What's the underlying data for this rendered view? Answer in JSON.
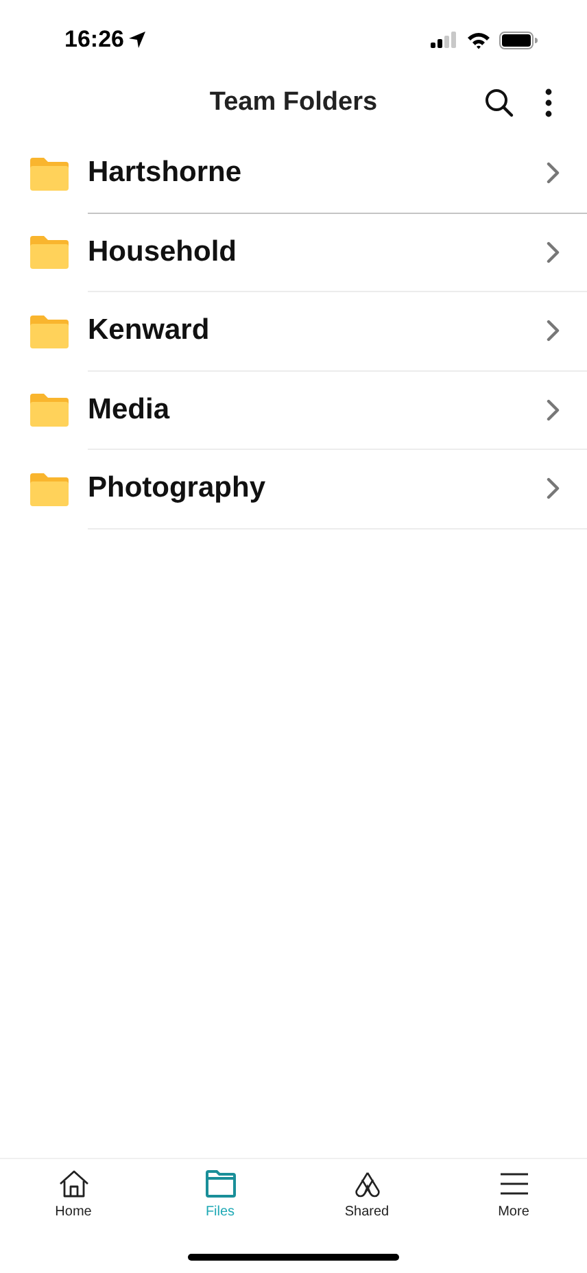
{
  "status_bar": {
    "time": "16:26"
  },
  "nav_bar": {
    "title": "Team Folders"
  },
  "folders": [
    {
      "name": "Hartshorne"
    },
    {
      "name": "Household"
    },
    {
      "name": "Kenward"
    },
    {
      "name": "Media"
    },
    {
      "name": "Photography"
    }
  ],
  "tab_bar": [
    {
      "label": "Home",
      "kind": "home",
      "selected": false
    },
    {
      "label": "Files",
      "kind": "files",
      "selected": true
    },
    {
      "label": "Shared",
      "kind": "shared",
      "selected": false
    },
    {
      "label": "More",
      "kind": "more",
      "selected": false
    }
  ]
}
